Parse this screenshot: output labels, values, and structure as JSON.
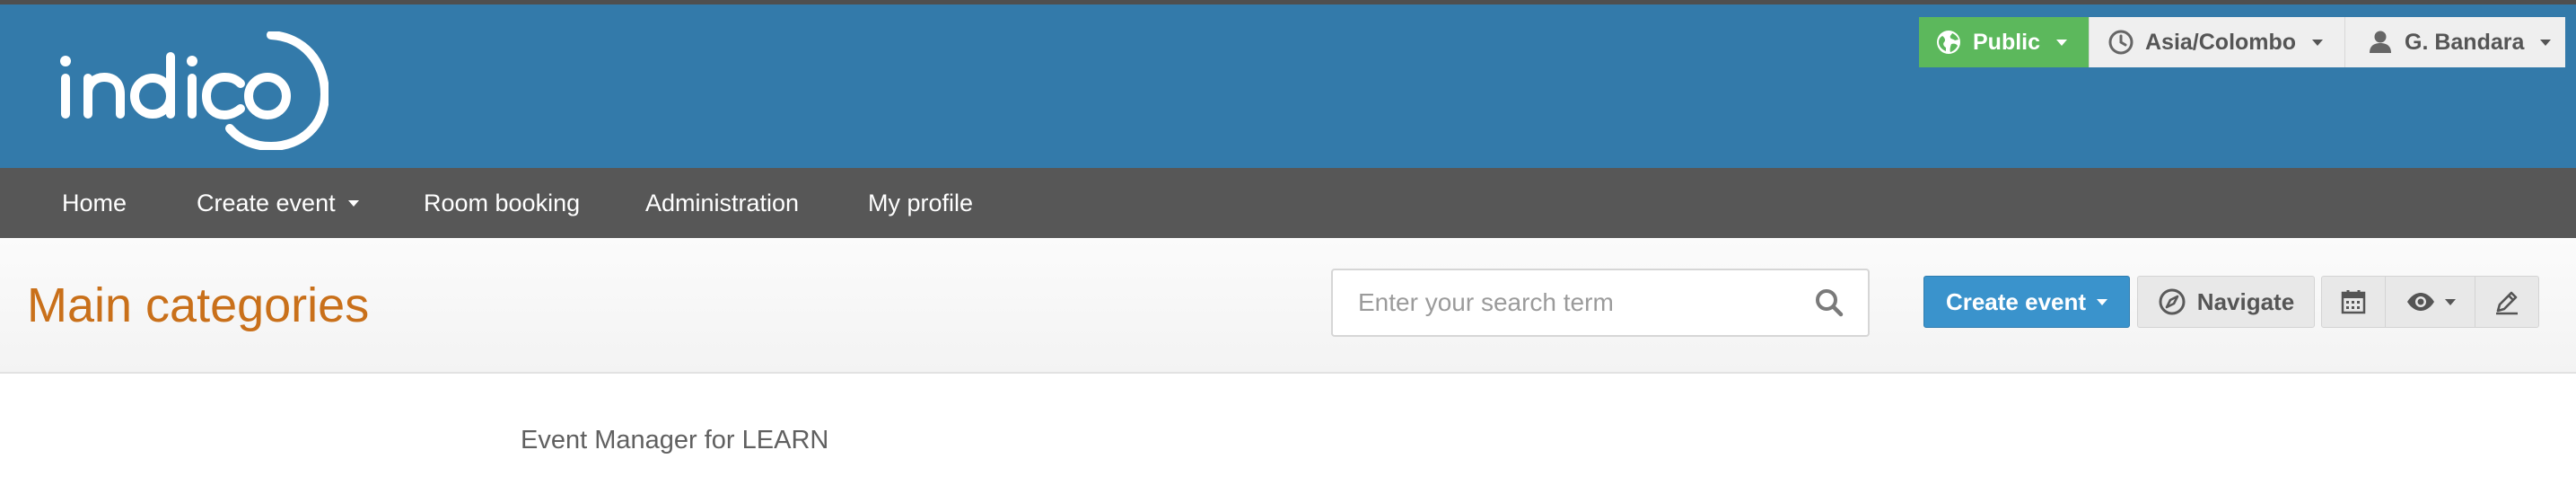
{
  "header": {
    "logo_text": "indico",
    "access_label": "Public",
    "timezone_label": "Asia/Colombo",
    "user_label": "G. Bandara",
    "icons": {
      "access": "globe-icon",
      "timezone": "clock-icon",
      "user": "user-icon"
    }
  },
  "navbar": {
    "items": [
      {
        "label": "Home"
      },
      {
        "label": "Create event",
        "dropdown": true
      },
      {
        "label": "Room booking"
      },
      {
        "label": "Administration"
      },
      {
        "label": "My profile"
      }
    ]
  },
  "titlebar": {
    "title": "Main categories",
    "search_placeholder": "Enter your search term",
    "create_event_label": "Create event",
    "navigate_label": "Navigate",
    "icons": [
      "calendar-icon",
      "eye-icon",
      "pencil-icon"
    ]
  },
  "content": {
    "description": "Event Manager for LEARN"
  },
  "colors": {
    "header_bg": "#337aaa",
    "navbar_bg": "#575757",
    "public_green": "#5cb85c",
    "title_orange": "#c9701a",
    "primary_blue": "#3a93cc"
  }
}
